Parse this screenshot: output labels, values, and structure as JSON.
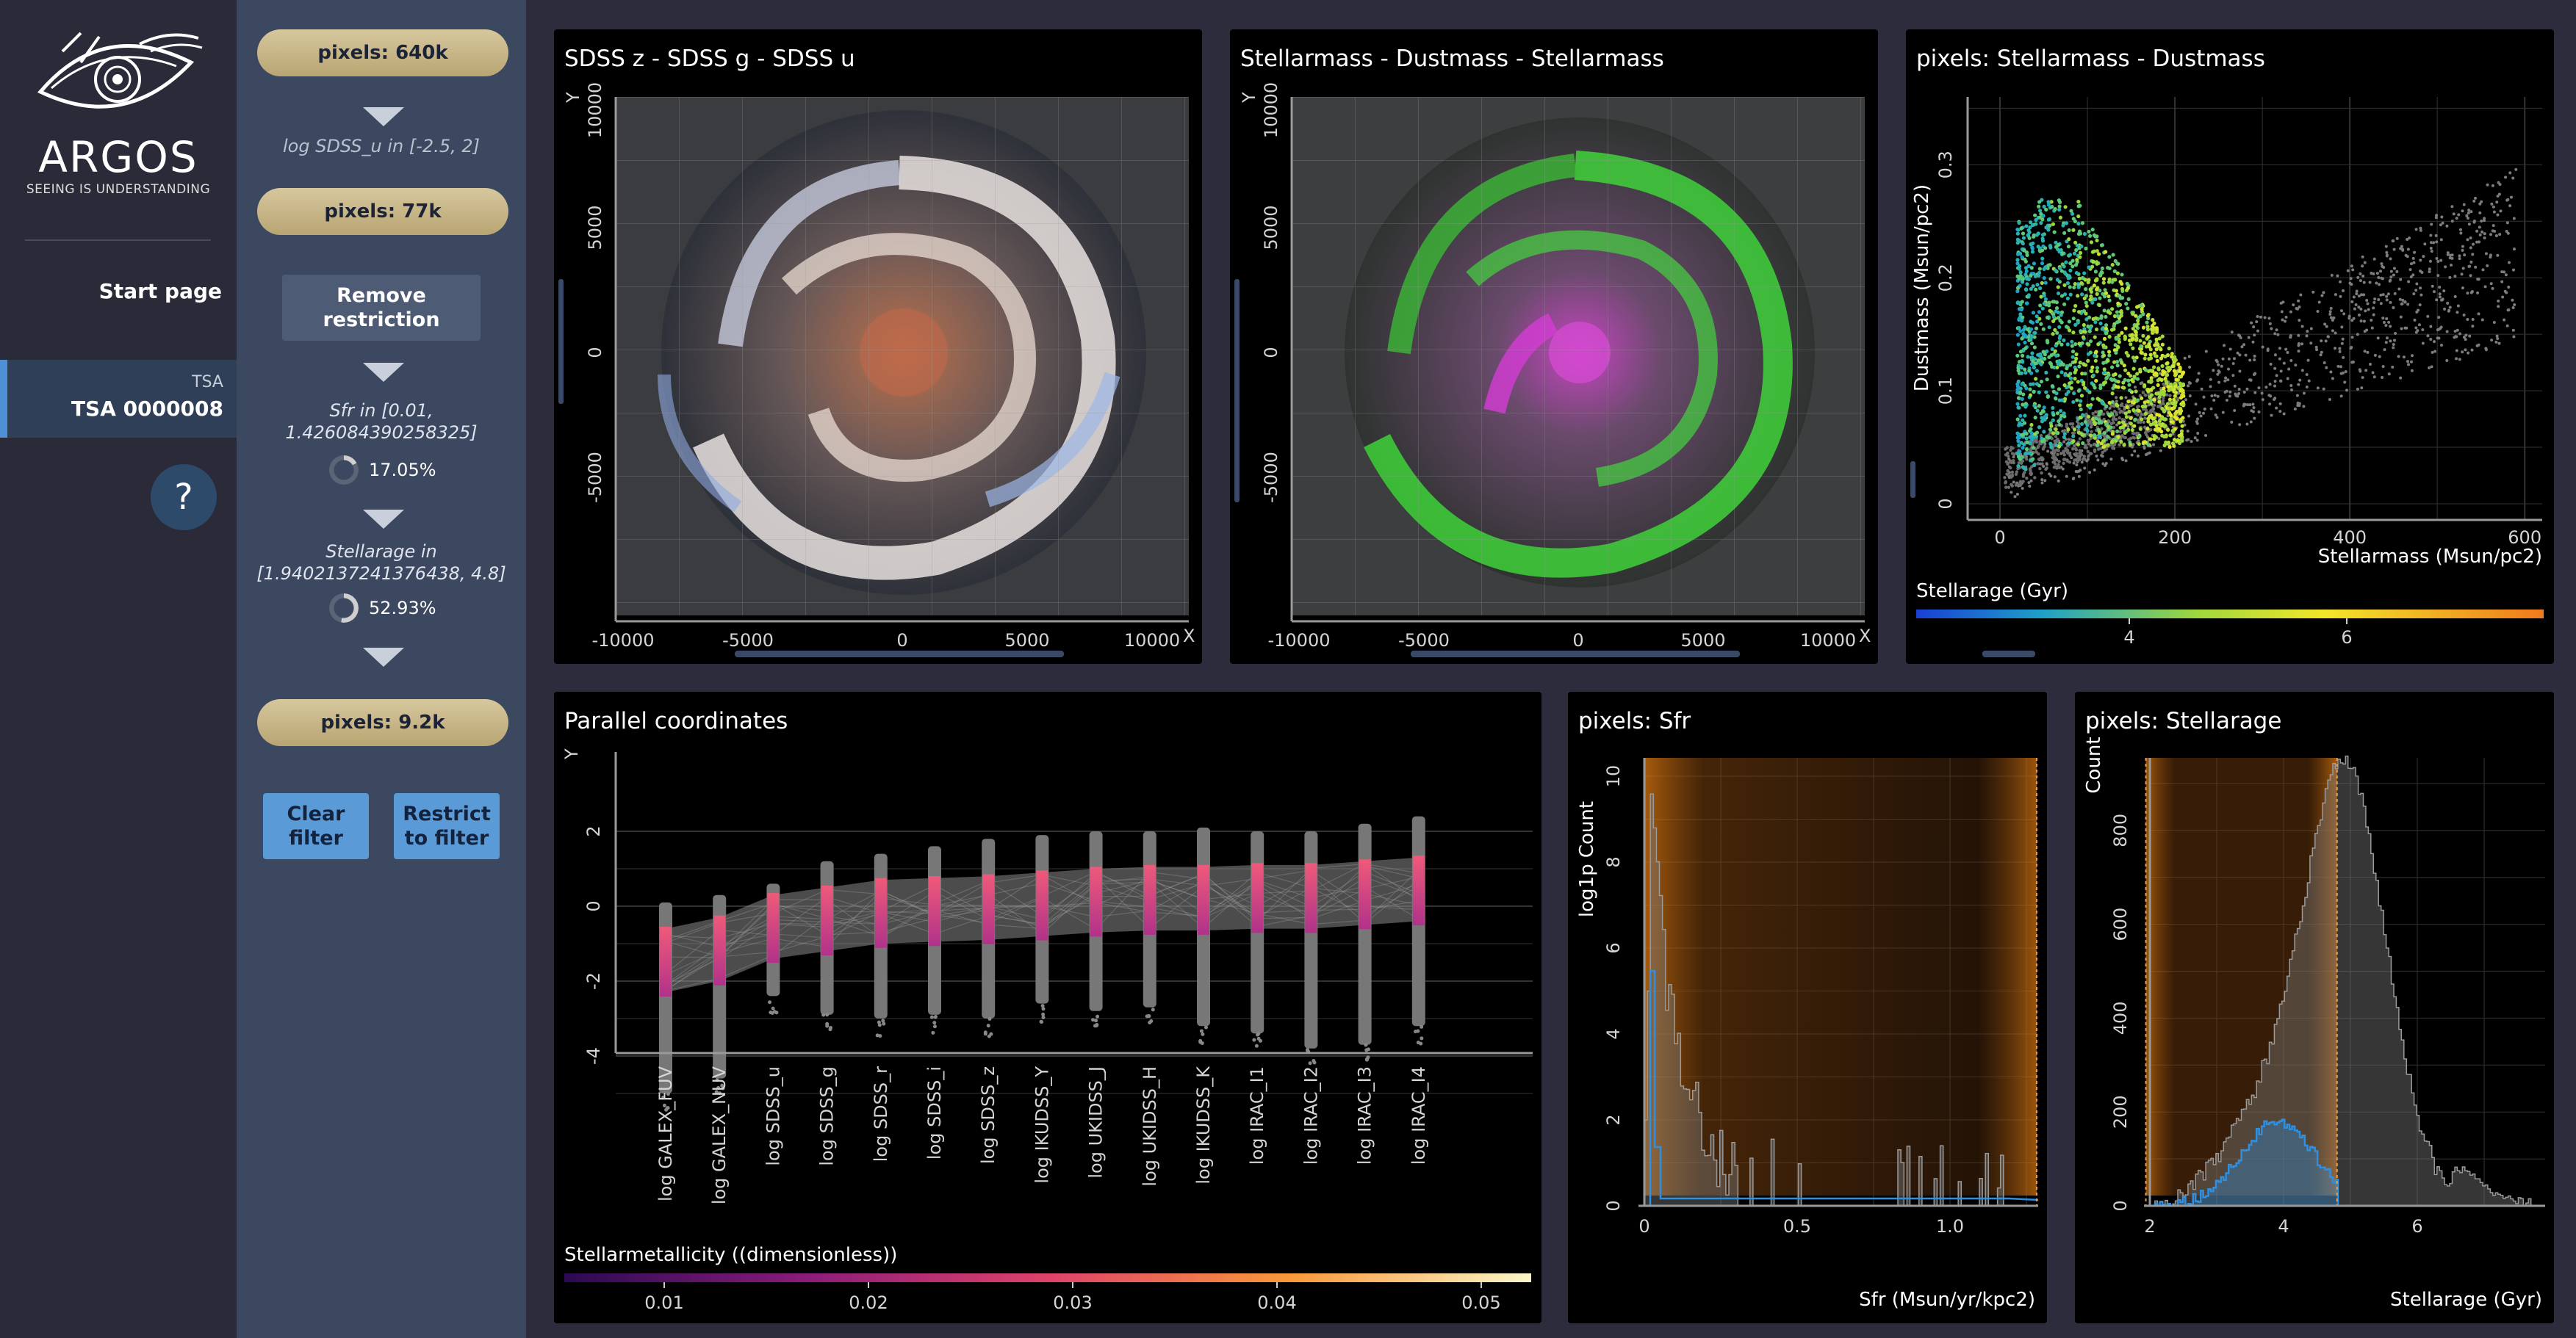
{
  "nav": {
    "logo_text": "ARGOS",
    "logo_subtitle": "SEEING IS UNDERSTANDING",
    "start_page": "Start page",
    "dataset_group": "TSA",
    "dataset_name": "TSA 0000008",
    "help": "?"
  },
  "filters": {
    "pill_1": "pixels: 640k",
    "filter_1": "log SDSS_u in [-2.5, 2]",
    "pill_2": "pixels: 77k",
    "remove_restriction": "Remove restriction",
    "filter_2_line1": "Sfr in [0.01,",
    "filter_2_line2": "1.426084390258325]",
    "filter_2_pct": "17.05%",
    "filter_2_fraction": 0.1705,
    "filter_3_line1": "Stellarage in",
    "filter_3_line2": "[1.9402137241376438, 4.8]",
    "filter_3_pct": "52.93%",
    "filter_3_fraction": 0.5293,
    "pill_3": "pixels: 9.2k",
    "clear_filter": "Clear filter",
    "restrict_filter": "Restrict to filter"
  },
  "panels": {
    "rgb1": {
      "title": "SDSS z - SDSS g - SDSS u",
      "xlabel": "X",
      "ylabel": "Y",
      "xticks": [
        "-10000",
        "-5000",
        "0",
        "5000",
        "10000"
      ],
      "yticks": [
        "10000",
        "5000",
        "0",
        "-5000"
      ]
    },
    "rgb2": {
      "title": "Stellarmass - Dustmass - Stellarmass",
      "xlabel": "X",
      "ylabel": "Y",
      "xticks": [
        "-10000",
        "-5000",
        "0",
        "5000",
        "10000"
      ],
      "yticks": [
        "10000",
        "5000",
        "0",
        "-5000"
      ]
    },
    "scatter": {
      "title": "pixels: Stellarmass - Dustmass",
      "xlabel": "Stellarmass (Msun/pc2)",
      "ylabel": "Dustmass (Msun/pc2)",
      "xticks": [
        "0",
        "200",
        "400",
        "600"
      ],
      "yticks": [
        "0",
        "0.1",
        "0.2",
        "0.3"
      ],
      "colorbar_title": "Stellarage (Gyr)",
      "colorbar_ticks": [
        "4",
        "6"
      ]
    },
    "parallel": {
      "title": "Parallel coordinates",
      "ylabel": "Y",
      "yticks": [
        "2",
        "0",
        "-2",
        "-4"
      ],
      "colorbar_title": "Stellarmetallicity ((dimensionless))",
      "colorbar_ticks": [
        "0.01",
        "0.02",
        "0.03",
        "0.04",
        "0.05"
      ],
      "axes": [
        "log GALEX_FUV",
        "log GALEX_NUV",
        "log SDSS_u",
        "log SDSS_g",
        "log SDSS_r",
        "log SDSS_i",
        "log SDSS_z",
        "log IKUDSS_Y",
        "log UKIDSS_J",
        "log UKIDSS_H",
        "log IKUDSS_K",
        "log IRAC_I1",
        "log IRAC_I2",
        "log IRAC_I3",
        "log IRAC_I4"
      ]
    },
    "hist_sfr": {
      "title": "pixels: Sfr",
      "xlabel": "Sfr (Msun/yr/kpc2)",
      "ylabel": "log1p Count",
      "xticks": [
        "0",
        "0.5",
        "1.0"
      ],
      "yticks": [
        "0",
        "2",
        "4",
        "6",
        "8",
        "10"
      ]
    },
    "hist_age": {
      "title": "pixels: Stellarage",
      "xlabel": "Stellarage (Gyr)",
      "ylabel": "Count",
      "xticks": [
        "2",
        "4",
        "6"
      ],
      "yticks": [
        "0",
        "200",
        "400",
        "600",
        "800"
      ]
    }
  },
  "colors": {
    "accent_blue": "#5a9ad6",
    "pill_gold": "#c8b684",
    "selection_orange": "#e07a10",
    "hist_blue": "#2f8fe0"
  }
}
